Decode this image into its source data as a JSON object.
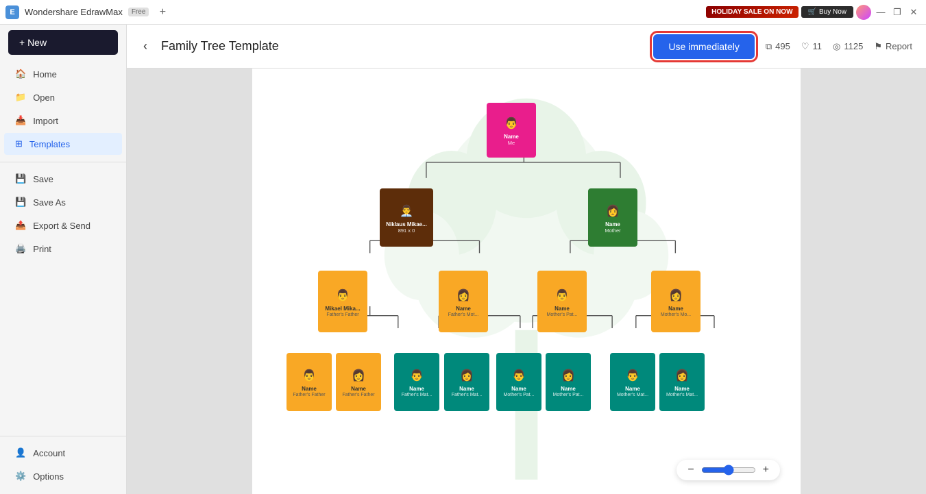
{
  "titlebar": {
    "app_name": "Wondershare EdrawMax",
    "free_badge": "Free",
    "holiday_btn": "HOLIDAY SALE ON NOW",
    "buy_btn": "Buy Now",
    "new_tab_symbol": "+"
  },
  "window_controls": {
    "minimize": "—",
    "maximize": "❐",
    "close": "✕"
  },
  "sidebar": {
    "new_btn": "+ New",
    "items": [
      {
        "id": "home",
        "label": "Home",
        "icon": "🏠"
      },
      {
        "id": "open",
        "label": "Open",
        "icon": "📂"
      },
      {
        "id": "import",
        "label": "Import",
        "icon": "📥"
      },
      {
        "id": "templates",
        "label": "Templates",
        "icon": "⊞",
        "active": true
      },
      {
        "id": "save",
        "label": "Save",
        "icon": "💾"
      },
      {
        "id": "save-as",
        "label": "Save As",
        "icon": "💾"
      },
      {
        "id": "export",
        "label": "Export & Send",
        "icon": "📤"
      },
      {
        "id": "print",
        "label": "Print",
        "icon": "🖨️"
      }
    ],
    "bottom_items": [
      {
        "id": "account",
        "label": "Account",
        "icon": "👤"
      },
      {
        "id": "options",
        "label": "Options",
        "icon": "⚙️"
      }
    ]
  },
  "header": {
    "back_icon": "‹",
    "title": "Family Tree Template",
    "use_immediately": "Use immediately",
    "copies_count": "495",
    "likes_count": "11",
    "views_count": "1125",
    "report_label": "Report"
  },
  "tree": {
    "nodes": [
      {
        "id": "me",
        "name": "Name",
        "label": "Me",
        "type": "pink",
        "gender": "male"
      },
      {
        "id": "father",
        "name": "Niklaus Mikae...",
        "label": "891 x 0",
        "type": "brown",
        "gender": "male"
      },
      {
        "id": "mother",
        "name": "Name",
        "label": "Mother",
        "type": "green_dark",
        "gender": "female"
      },
      {
        "id": "ff",
        "name": "Mikael Mika...",
        "label": "Father's Father",
        "type": "yellow",
        "gender": "male"
      },
      {
        "id": "fm",
        "name": "Name",
        "label": "Father's Mot...",
        "type": "yellow",
        "gender": "female"
      },
      {
        "id": "mf",
        "name": "Name",
        "label": "Mother's Pat...",
        "type": "yellow",
        "gender": "male"
      },
      {
        "id": "mm",
        "name": "Name",
        "label": "Mother's Mo...",
        "type": "yellow",
        "gender": "female"
      },
      {
        "id": "fff",
        "name": "Name",
        "label": "Father's Father",
        "type": "yellow",
        "gender": "male"
      },
      {
        "id": "ffm",
        "name": "Name",
        "label": "Father's Father",
        "type": "yellow",
        "gender": "female"
      },
      {
        "id": "fmm1",
        "name": "Name",
        "label": "Father's Mat...",
        "type": "teal",
        "gender": "male"
      },
      {
        "id": "fmm2",
        "name": "Name",
        "label": "Father's Mat...",
        "type": "teal",
        "gender": "female"
      },
      {
        "id": "mff1",
        "name": "Name",
        "label": "Mother's Pat...",
        "type": "teal",
        "gender": "male"
      },
      {
        "id": "mff2",
        "name": "Name",
        "label": "Mother's Pat...",
        "type": "teal",
        "gender": "female"
      },
      {
        "id": "mmm1",
        "name": "Name",
        "label": "Mother's Mat...",
        "type": "teal",
        "gender": "male"
      },
      {
        "id": "mmm2",
        "name": "Name",
        "label": "Mother's Mat...",
        "type": "teal",
        "gender": "female"
      }
    ]
  },
  "zoom": {
    "min_btn": "−",
    "max_btn": "+",
    "value": 50
  }
}
